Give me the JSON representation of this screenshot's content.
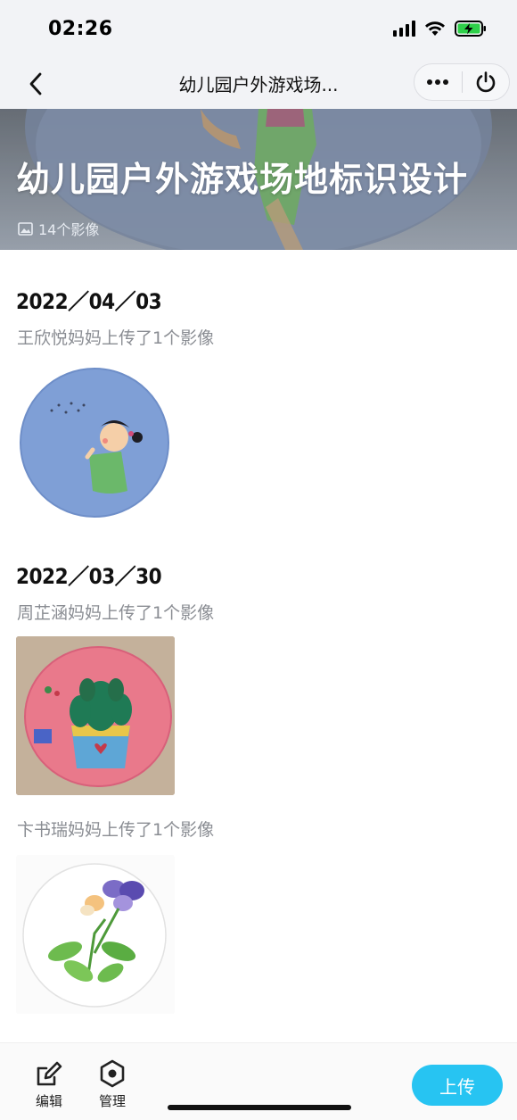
{
  "status_bar": {
    "time": "02:26"
  },
  "nav": {
    "title": "幼儿园户外游戏场..."
  },
  "banner": {
    "title": "幼儿园户外游戏场地标识设计",
    "count": "14个影像"
  },
  "groups": [
    {
      "date": "2022／04／03",
      "uploads": [
        {
          "uploader": "王欣悦妈妈上传了1个影像"
        }
      ]
    },
    {
      "date": "2022／03／30",
      "uploads": [
        {
          "uploader": "周芷涵妈妈上传了1个影像"
        },
        {
          "uploader": "卞书瑞妈妈上传了1个影像"
        }
      ]
    }
  ],
  "toolbar": {
    "edit_label": "编辑",
    "manage_label": "管理",
    "upload_label": "上传"
  },
  "colors": {
    "accent": "#27c4f2",
    "nav_bg": "#f2f3f6",
    "subtle_text": "#8a8d93"
  }
}
